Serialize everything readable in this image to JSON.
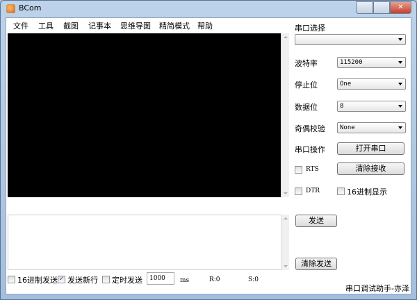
{
  "window": {
    "title": "BCom"
  },
  "menu": [
    "文件",
    "工具",
    "截图",
    "记事本",
    "思维导图",
    "精简模式",
    "帮助"
  ],
  "port": {
    "label": "串口选择",
    "value": ""
  },
  "baud": {
    "label": "波特率",
    "value": "115200"
  },
  "stop": {
    "label": "停止位",
    "value": "One"
  },
  "data_bits": {
    "label": "数据位",
    "value": "8"
  },
  "parity": {
    "label": "奇偶校验",
    "value": "None"
  },
  "op": {
    "label": "串口操作",
    "open": "打开串口",
    "clear_recv": "清除接收"
  },
  "rts": {
    "label": "RTS",
    "checked": false
  },
  "dtr": {
    "label": "DTR",
    "checked": false
  },
  "hex_show": {
    "label": "16进制显示",
    "checked": false
  },
  "send": "发送",
  "clear_send": "清除发送",
  "bottom": {
    "hex_send": "16进制发送",
    "newline": "发送新行",
    "timed": "定时发送",
    "interval": "1000",
    "unit": "ms",
    "r": "R:0",
    "s": "S:0",
    "footer": "串口调试助手-亦泽"
  }
}
